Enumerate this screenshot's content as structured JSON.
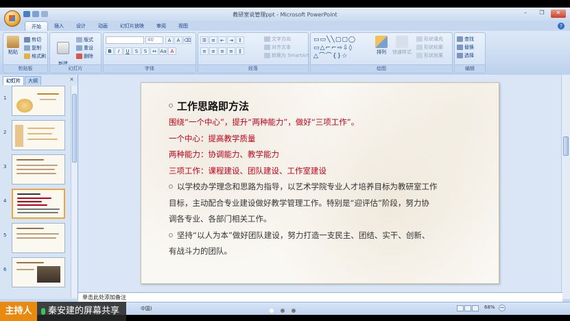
{
  "window": {
    "title": "教研室说管理ppt - Microsoft PowerPoint"
  },
  "ribbon_tabs": [
    "开始",
    "插入",
    "设计",
    "动画",
    "幻灯片放映",
    "审阅",
    "视图"
  ],
  "clipboard": {
    "cut": "剪切",
    "copy": "复制",
    "painter": "格式刷",
    "paste": "粘贴",
    "label": "剪贴板"
  },
  "slides_group": {
    "new_slide": "新建\n幻灯片",
    "layout": "版式",
    "reset": "重设",
    "delete": "删除",
    "label": "幻灯片"
  },
  "font_group": {
    "font_size": "40",
    "label": "字体"
  },
  "paragraph_group": {
    "text_direction": "文字方向",
    "align_text": "对齐文本",
    "smartart": "转换为 SmartArt",
    "label": "段落"
  },
  "drawing_group": {
    "arrange": "排列",
    "quick_styles": "快速样式",
    "fill": "形状填充",
    "outline": "形状轮廓",
    "effects": "形状效果",
    "label": "绘图"
  },
  "editing_group": {
    "find": "查找",
    "replace": "替换",
    "select": "选择",
    "label": "编辑"
  },
  "left_pane": {
    "tab_slides": "幻灯片",
    "tab_outline": "大纲",
    "close": "×",
    "slide_numbers": [
      "1",
      "2",
      "3",
      "4",
      "5",
      "6"
    ]
  },
  "slide": {
    "title": "工作思路即方法",
    "line1": "围绕“一个中心”，提升“两种能力”，做好“三项工作”。",
    "line2": "一个中心：提高教学质量",
    "line3": "两种能力：协调能力、教学能力",
    "line4": "三项工作：课程建设、团队建设、工作室建设",
    "para1_l1": "以学校办学理念和思路为指导，以艺术学院专业人才培养目标为教研室工作",
    "para1_l2": "目标，主动配合专业建设做好教学管理工作。特别是“迎评估”阶段，努力协",
    "para1_l3": "调各专业、各部门相关工作。",
    "para2_l1": "坚持“以人为本”做好团队建设，努力打造一支民主、团结、实干、创新、",
    "para2_l2": "有战斗力的团队。"
  },
  "notes": {
    "placeholder": "单击此处添加备注"
  },
  "status": {
    "language": "中国)",
    "zoom": "68%",
    "zoom_out": "−"
  },
  "presenter": {
    "label": "主持人",
    "text": "秦安建的屏幕共享"
  }
}
